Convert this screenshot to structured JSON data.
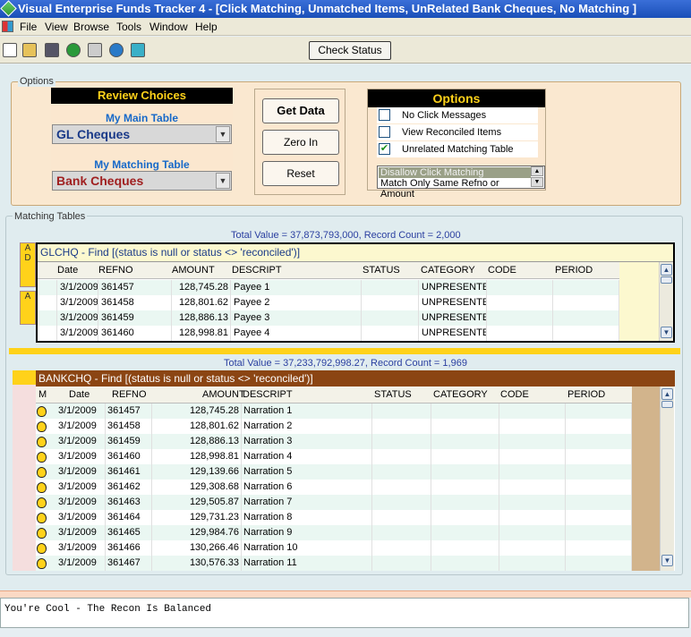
{
  "window": {
    "title": "Visual Enterprise Funds Tracker 4 - [Click Matching, Unmatched Items, UnRelated Bank Cheques, No Matching ]"
  },
  "menu": {
    "items": [
      "File",
      "View",
      "Browse",
      "Tools",
      "Window",
      "Help"
    ]
  },
  "toolbar": {
    "check_status_label": "Check Status",
    "icons": [
      "new-doc-icon",
      "open-folder-icon",
      "save-icon",
      "help-icon",
      "keyboard-icon",
      "globe-icon",
      "grid-icon"
    ]
  },
  "options": {
    "legend": "Options",
    "review_choices_title": "Review Choices",
    "main_table_label": "My Main Table",
    "main_table_value": "GL Cheques",
    "matching_table_label": "My Matching Table",
    "matching_table_value": "Bank Cheques",
    "get_data_label": "Get Data",
    "zero_in_label": "Zero In",
    "reset_label": "Reset",
    "options_title": "Options",
    "chk_no_click": "No Click Messages",
    "chk_view_reconciled": "View Reconciled Items",
    "chk_unrelated": "Unrelated Matching Table",
    "chk_unrelated_mark": "✔",
    "list_item1": "Disallow Click Matching",
    "list_item2": "Match Only Same Refno or Amount"
  },
  "matching_tables": {
    "legend": "Matching Tables",
    "side_tab_a": "A",
    "side_tab_d": "D",
    "gl": {
      "total": "Total Value = 37,873,793,000, Record Count = 2,000",
      "header": "GLCHQ - Find [(status is null or status <> 'reconciled')]",
      "columns": [
        "Date",
        "REFNO",
        "AMOUNT",
        "DESCRIPT",
        "STATUS",
        "CATEGORY",
        "CODE",
        "PERIOD"
      ],
      "rows": [
        [
          "3/1/2009",
          "361457",
          "128,745.28",
          "Payee 1",
          "",
          "UNPRESENTE",
          "",
          ""
        ],
        [
          "3/1/2009",
          "361458",
          "128,801.62",
          "Payee 2",
          "",
          "UNPRESENTE",
          "",
          ""
        ],
        [
          "3/1/2009",
          "361459",
          "128,886.13",
          "Payee 3",
          "",
          "UNPRESENTE",
          "",
          ""
        ],
        [
          "3/1/2009",
          "361460",
          "128,998.81",
          "Payee 4",
          "",
          "UNPRESENTE",
          "",
          ""
        ]
      ]
    },
    "bank": {
      "total": "Total Value = 37,233,792,998.27, Record Count = 1,969",
      "header": "BANKCHQ - Find [(status is null or status <> 'reconciled')]",
      "columns": [
        "M",
        "Date",
        "REFNO",
        "AMOUNT",
        "DESCRIPT",
        "STATUS",
        "CATEGORY",
        "CODE",
        "PERIOD"
      ],
      "rows": [
        [
          "3/1/2009",
          "361457",
          "128,745.28",
          "Narration 1"
        ],
        [
          "3/1/2009",
          "361458",
          "128,801.62",
          "Narration 2"
        ],
        [
          "3/1/2009",
          "361459",
          "128,886.13",
          "Narration 3"
        ],
        [
          "3/1/2009",
          "361460",
          "128,998.81",
          "Narration 4"
        ],
        [
          "3/1/2009",
          "361461",
          "129,139.66",
          "Narration 5"
        ],
        [
          "3/1/2009",
          "361462",
          "129,308.68",
          "Narration 6"
        ],
        [
          "3/1/2009",
          "361463",
          "129,505.87",
          "Narration 7"
        ],
        [
          "3/1/2009",
          "361464",
          "129,731.23",
          "Narration 8"
        ],
        [
          "3/1/2009",
          "361465",
          "129,984.76",
          "Narration 9"
        ],
        [
          "3/1/2009",
          "361466",
          "130,266.46",
          "Narration 10"
        ],
        [
          "3/1/2009",
          "361467",
          "130,576.33",
          "Narration 11"
        ]
      ]
    }
  },
  "status": {
    "message": "You're Cool - The Recon Is Balanced"
  },
  "colors": {
    "title_bar": "#1a4fb8",
    "accent_yellow": "#ffd21a",
    "bank_header": "#8b4513",
    "row_alt": "#eaf7f2"
  }
}
